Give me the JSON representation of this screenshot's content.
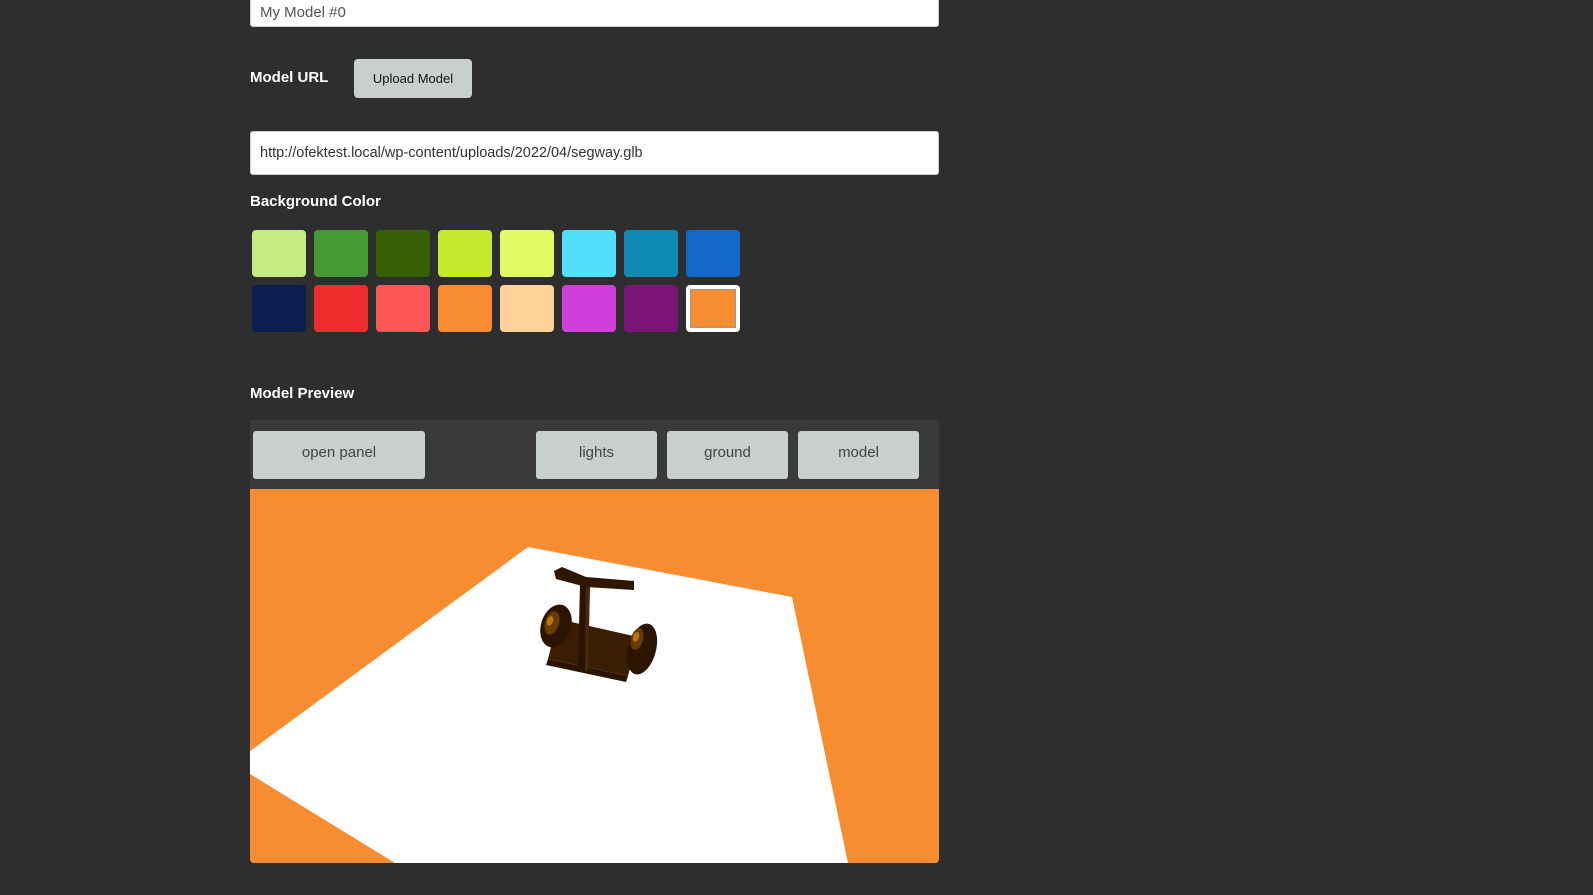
{
  "model_name": {
    "value": "My Model #0"
  },
  "model_url": {
    "label": "Model URL",
    "upload_label": "Upload Model",
    "value": "http://ofektest.local/wp-content/uploads/2022/04/segway.glb"
  },
  "background_color": {
    "label": "Background Color",
    "selected": "#f88c30",
    "swatches": [
      "#c6ec80",
      "#459a33",
      "#356003",
      "#c6e82e",
      "#e2fb64",
      "#50e0fe",
      "#0f8ab5",
      "#1568c8",
      "#0c1d4f",
      "#ee2c2c",
      "#fd5656",
      "#f88c30",
      "#fed298",
      "#d23edc",
      "#7c1477",
      "#f88c30"
    ]
  },
  "model_preview": {
    "label": "Model Preview",
    "buttons": {
      "open_panel": "open panel",
      "lights": "lights",
      "ground": "ground",
      "model": "model"
    },
    "scene": {
      "background": "#f88c30",
      "ground": "#ffffff",
      "model": "segway-model"
    }
  }
}
